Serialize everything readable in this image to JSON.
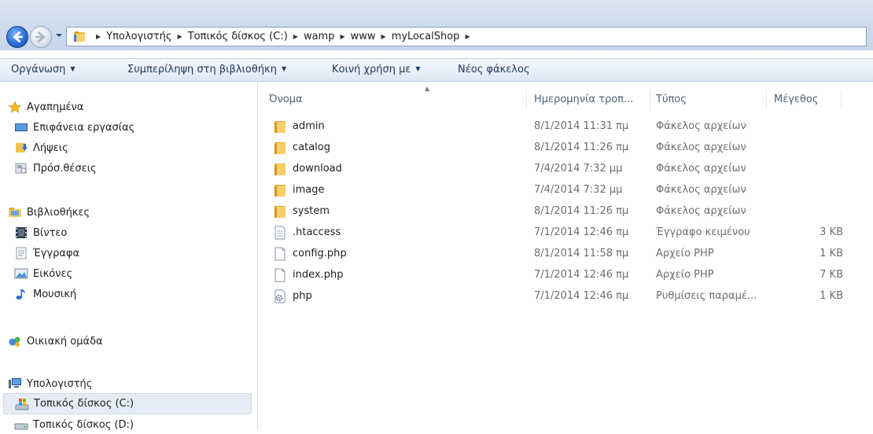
{
  "breadcrumb": [
    "Υπολογιστής",
    "Τοπικός δίσκος (C:)",
    "wamp",
    "www",
    "myLocalShop"
  ],
  "toolbar": {
    "organize": "Οργάνωση",
    "include_library": "Συμπερίληψη στη βιβλιοθήκη",
    "share_with": "Κοινή χρήση με",
    "new_folder": "Νέος φάκελος"
  },
  "nav": {
    "favorites": "Αγαπημένα",
    "desktop": "Επιφάνεια εργασίας",
    "downloads": "Λήψεις",
    "recent": "Πρόσ.θέσεις",
    "libraries": "Βιβλιοθήκες",
    "videos": "Βίντεο",
    "documents": "Έγγραφα",
    "pictures": "Εικόνες",
    "music": "Μουσική",
    "homegroup": "Οικιακή ομάδα",
    "computer": "Υπολογιστής",
    "disk_c": "Τοπικός δίσκος (C:)",
    "disk_d": "Τοπικός δίσκος (D:)"
  },
  "columns": {
    "name": "Όνομα",
    "date": "Ημερομηνία τροπ...",
    "type": "Τύπος",
    "size": "Μέγεθος"
  },
  "files": [
    {
      "name": "admin",
      "date": "8/1/2014 11:31 πμ",
      "type": "Φάκελος αρχείων",
      "size": "",
      "icon": "folder-icon"
    },
    {
      "name": "catalog",
      "date": "8/1/2014 11:26 πμ",
      "type": "Φάκελος αρχείων",
      "size": "",
      "icon": "folder-icon"
    },
    {
      "name": "download",
      "date": "7/4/2014 7:32 μμ",
      "type": "Φάκελος αρχείων",
      "size": "",
      "icon": "folder-icon"
    },
    {
      "name": "image",
      "date": "7/4/2014 7:32 μμ",
      "type": "Φάκελος αρχείων",
      "size": "",
      "icon": "folder-icon"
    },
    {
      "name": "system",
      "date": "8/1/2014 11:26 πμ",
      "type": "Φάκελος αρχείων",
      "size": "",
      "icon": "folder-icon"
    },
    {
      "name": ".htaccess",
      "date": "7/1/2014 12:46 πμ",
      "type": "Έγγραφο κειμένου",
      "size": "3 KB",
      "icon": "text-file-icon"
    },
    {
      "name": "config.php",
      "date": "8/1/2014 11:58 πμ",
      "type": "Αρχείο PHP",
      "size": "1 KB",
      "icon": "blank-file-icon"
    },
    {
      "name": "index.php",
      "date": "7/1/2014 12:46 πμ",
      "type": "Αρχείο PHP",
      "size": "7 KB",
      "icon": "blank-file-icon"
    },
    {
      "name": "php",
      "date": "7/1/2014 12:46 πμ",
      "type": "Ρυθμίσεις παραμέ...",
      "size": "1 KB",
      "icon": "settings-file-icon"
    }
  ]
}
